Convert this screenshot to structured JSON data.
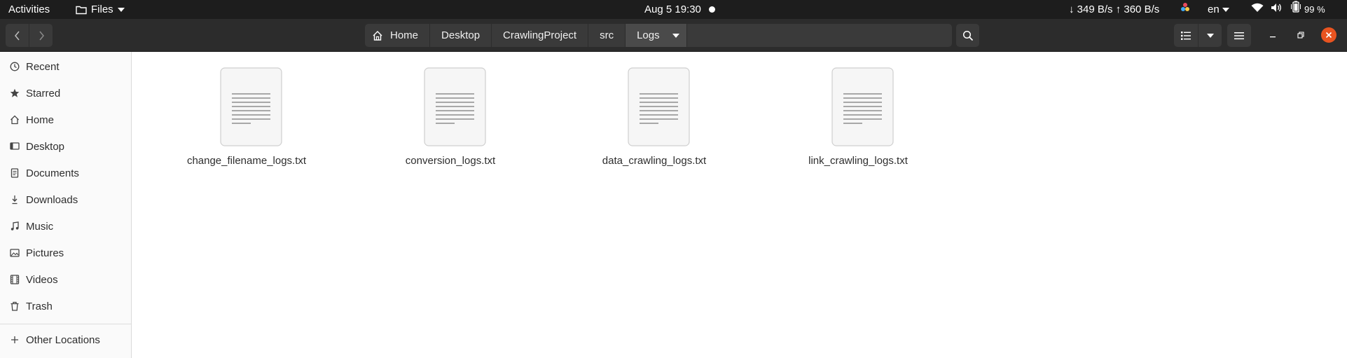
{
  "topbar": {
    "activities": "Activities",
    "files_menu": "Files",
    "clock": "Aug 5  19:30",
    "net_speed": "↓ 349 B/s ↑ 360 B/s",
    "language": "en",
    "battery_percent": "99 %"
  },
  "pathbar": {
    "crumbs": [
      "Home",
      "Desktop",
      "CrawlingProject",
      "src",
      "Logs"
    ]
  },
  "sidebar": {
    "items": [
      {
        "label": "Recent",
        "icon": "clock-icon"
      },
      {
        "label": "Starred",
        "icon": "star-icon"
      },
      {
        "label": "Home",
        "icon": "home-icon"
      },
      {
        "label": "Desktop",
        "icon": "desktop-icon"
      },
      {
        "label": "Documents",
        "icon": "document-icon"
      },
      {
        "label": "Downloads",
        "icon": "download-icon"
      },
      {
        "label": "Music",
        "icon": "music-icon"
      },
      {
        "label": "Pictures",
        "icon": "pictures-icon"
      },
      {
        "label": "Videos",
        "icon": "video-icon"
      },
      {
        "label": "Trash",
        "icon": "trash-icon"
      }
    ],
    "other_locations": "Other Locations"
  },
  "files": [
    {
      "name": "change_filename_logs.txt",
      "icon": "text-file-icon"
    },
    {
      "name": "conversion_logs.txt",
      "icon": "text-file-icon"
    },
    {
      "name": "data_crawling_logs.txt",
      "icon": "text-file-icon"
    },
    {
      "name": "link_crawling_logs.txt",
      "icon": "text-file-icon"
    }
  ],
  "colors": {
    "topbar_bg": "#1d1d1d",
    "headerbar_bg": "#2c2c2c",
    "close_button": "#e95420",
    "sidebar_bg": "#fafafa"
  }
}
